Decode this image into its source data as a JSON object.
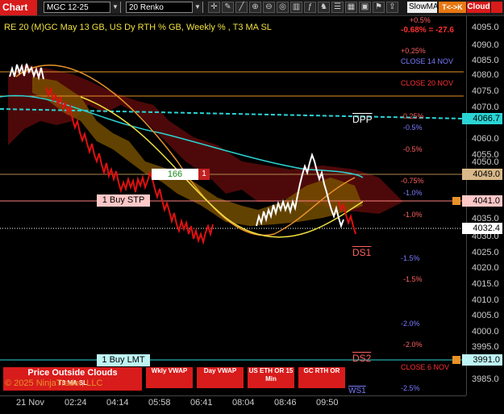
{
  "toolbar": {
    "chart_label": "Chart",
    "instrument": "MGC 12-25",
    "bar_type": "20 Renko",
    "slow_ma": "SlowMA",
    "tck_button": "T<->K",
    "cloud_button": "Cloud"
  },
  "chart": {
    "title": "RE 20  (M)GC May 13 GB, US Dy RTH % GB, Weekly % , T3 MA SL",
    "change": "-0.68% = -27.6",
    "close_14": "CLOSE 14 NOV",
    "close_20": "CLOSE 20 NOV",
    "close_6": "CLOSE 6 NOV",
    "dpp": "DPP",
    "ds1": "DS1",
    "ds2": "DS2",
    "ws1": "WS1",
    "box_value": "166",
    "box_count": "1",
    "buy_stp": "1 Buy STP",
    "buy_lmt": "1 Buy LMT",
    "copyright": "© 2025 NinjaTrader, LLC",
    "percent_labels": [
      "+0.5%",
      "+0.25%",
      "-0.25%",
      "-0.5%",
      "-0.5%",
      "-0.75%",
      "-1.0%",
      "-1.0%",
      "-1.5%",
      "-1.5%",
      "-2.0%",
      "-2.0%",
      "-2.5%"
    ]
  },
  "buttons": {
    "price_outside": "Price Outside Clouds",
    "t3": "T3 MA SL",
    "wkly_vwap": "Wkly VWAP",
    "day_vwap": "Day VWAP",
    "us_eth": "US ETH OR 15 Min",
    "gc_rth": "GC RTH OR"
  },
  "y_axis": [
    "4095.0",
    "4090.0",
    "4085.0",
    "4080.0",
    "4075.0",
    "4070.0",
    "4060.0",
    "4055.0",
    "4050.0",
    "4035.0",
    "4030.0",
    "4025.0",
    "4020.0",
    "4015.0",
    "4010.0",
    "4005.0",
    "4000.0",
    "3995.0",
    "3985.0"
  ],
  "price_tags": {
    "dpp": "4066.7",
    "level1": "4049.0",
    "stp": "4041.0",
    "last": "4032.4",
    "lmt": "3991.0"
  },
  "x_axis": [
    "21 Nov",
    "02:24",
    "04:14",
    "05:58",
    "06:41",
    "08:04",
    "08:46",
    "09:50"
  ],
  "colors": {
    "accent_red": "#d81b1b",
    "cyan": "#2ad4d4",
    "orange": "#e8922a",
    "yellow": "#f0e040"
  }
}
